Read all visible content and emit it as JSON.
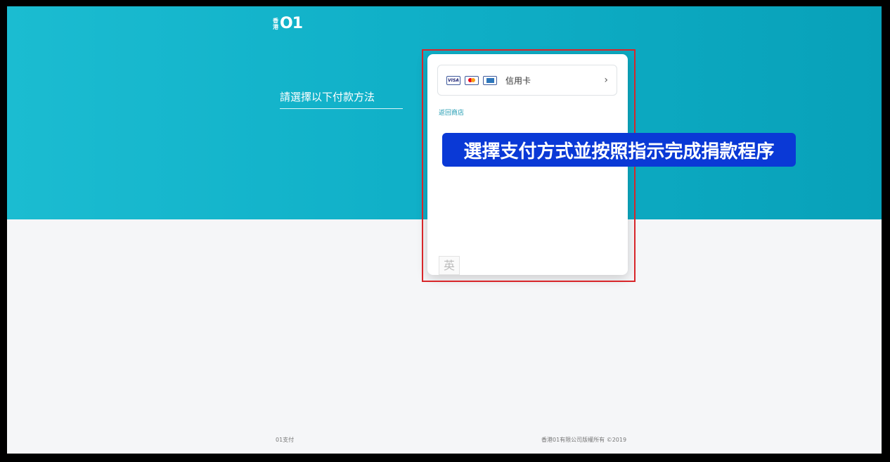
{
  "logo": {
    "small_top": "香",
    "small_bottom": "港",
    "main": "O1"
  },
  "sidebar": {
    "title": "請選擇以下付款方法"
  },
  "payment": {
    "method_label": "信用卡",
    "card_logos": [
      "visa-logo",
      "mastercard-logo",
      "amex-logo"
    ],
    "visa_text": "VISA",
    "chevron": "›",
    "back_link": "返回商店",
    "language_button": "英"
  },
  "overlay": {
    "instruction": "選擇支付方式並按照指示完成捐款程序"
  },
  "footer": {
    "left": "01支付",
    "right": "香港01有限公司版權所有 ©2019"
  },
  "colors": {
    "hero_start": "#1bbcd1",
    "hero_end": "#08a1b9",
    "banner": "#0a39d6",
    "highlight_border": "#d8262a",
    "link": "#1f9bb2"
  }
}
